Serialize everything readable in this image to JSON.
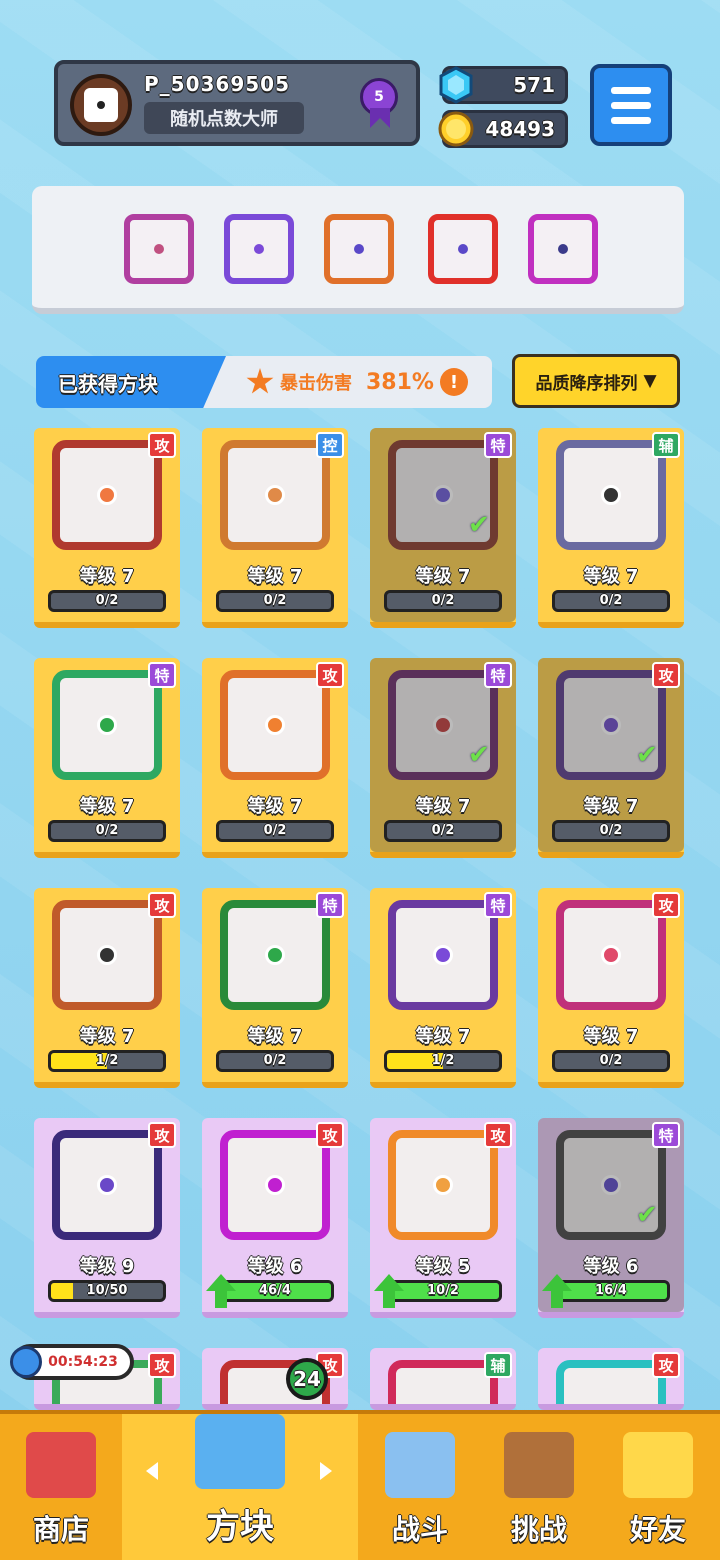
{
  "player": {
    "name": "P_50369505",
    "title": "随机点数大师",
    "rank": "5"
  },
  "currency": {
    "gems": "571",
    "gold": "48493"
  },
  "section": {
    "label": "已获得方块",
    "crit_label": "暴击伤害",
    "crit_value": "381%",
    "crit_info": "!"
  },
  "sort": {
    "label": "品质降序排列",
    "arrow": "▼"
  },
  "cards": [
    {
      "tag": "攻",
      "tag_type": "atk",
      "level": "等级 7",
      "progress": "0/2",
      "fill": 0,
      "frame": "#b0392f",
      "dotc": "#f07840",
      "owned": false
    },
    {
      "tag": "控",
      "tag_type": "ctl",
      "level": "等级 7",
      "progress": "0/2",
      "fill": 0,
      "frame": "#d07a30",
      "dotc": "#e08a48",
      "owned": false
    },
    {
      "tag": "特",
      "tag_type": "spc",
      "level": "等级 7",
      "progress": "0/2",
      "fill": 0,
      "frame": "#8a3a2a",
      "dotc": "#6a58d8",
      "owned": true
    },
    {
      "tag": "辅",
      "tag_type": "sup",
      "level": "等级 7",
      "progress": "0/2",
      "fill": 0,
      "frame": "#6a6aa0",
      "dotc": "#333333",
      "owned": false
    },
    {
      "tag": "特",
      "tag_type": "spc",
      "level": "等级 7",
      "progress": "0/2",
      "fill": 0,
      "frame": "#2ea862",
      "dotc": "#2ea84a",
      "owned": false
    },
    {
      "tag": "攻",
      "tag_type": "atk",
      "level": "等级 7",
      "progress": "0/2",
      "fill": 0,
      "frame": "#e0702a",
      "dotc": "#f08030",
      "owned": false
    },
    {
      "tag": "特",
      "tag_type": "spc",
      "level": "等级 7",
      "progress": "0/2",
      "fill": 0,
      "frame": "#6a2a6a",
      "dotc": "#c03a3a",
      "owned": true
    },
    {
      "tag": "攻",
      "tag_type": "atk",
      "level": "等级 7",
      "progress": "0/2",
      "fill": 0,
      "frame": "#5a3a8a",
      "dotc": "#6a48c8",
      "owned": true
    },
    {
      "tag": "攻",
      "tag_type": "atk",
      "level": "等级 7",
      "progress": "1/2",
      "fill": 0.5,
      "frame": "#c05a2a",
      "dotc": "#333333",
      "owned": false
    },
    {
      "tag": "特",
      "tag_type": "spc",
      "level": "等级 7",
      "progress": "0/2",
      "fill": 0,
      "frame": "#2a8a3a",
      "dotc": "#2ea84a",
      "owned": false
    },
    {
      "tag": "特",
      "tag_type": "spc",
      "level": "等级 7",
      "progress": "1/2",
      "fill": 0.5,
      "frame": "#6a3aa0",
      "dotc": "#7a4ad8",
      "owned": false
    },
    {
      "tag": "攻",
      "tag_type": "atk",
      "level": "等级 7",
      "progress": "0/2",
      "fill": 0,
      "frame": "#c0307a",
      "dotc": "#e04a6a",
      "owned": false
    },
    {
      "tag": "攻",
      "tag_type": "atk",
      "level": "等级 9",
      "progress": "10/50",
      "fill": 0.2,
      "frame": "#3a2a7a",
      "dotc": "#6a48c8",
      "owned": false
    },
    {
      "tag": "攻",
      "tag_type": "atk",
      "level": "等级 6",
      "progress": "46/4",
      "fill": 1,
      "frame": "#c020d0",
      "dotc": "#c020d0",
      "owned": false,
      "upgrade": true
    },
    {
      "tag": "攻",
      "tag_type": "atk",
      "level": "等级 5",
      "progress": "10/2",
      "fill": 1,
      "frame": "#f08a2a",
      "dotc": "#f0a040",
      "owned": false,
      "upgrade": true
    },
    {
      "tag": "特",
      "tag_type": "spc",
      "level": "等级 6",
      "progress": "16/4",
      "fill": 1,
      "frame": "#444444",
      "dotc": "#5a48c8",
      "owned": true,
      "upgrade": true
    },
    {
      "tag": "攻",
      "tag_type": "atk",
      "frame": "#3aaa5a"
    },
    {
      "tag": "攻",
      "tag_type": "atk",
      "frame": "#c03030"
    },
    {
      "tag": "辅",
      "tag_type": "sup",
      "frame": "#d02a5a"
    },
    {
      "tag": "攻",
      "tag_type": "atk",
      "frame": "#2ac0c0"
    }
  ],
  "timer": "00:54:23",
  "chest_badge": "24",
  "nav": [
    {
      "label": "商店",
      "color": "#e04a4a"
    },
    {
      "label": "方块",
      "color": "#5ab0f0"
    },
    {
      "label": "战斗",
      "color": "#8ac0f0"
    },
    {
      "label": "挑战",
      "color": "#b0703a"
    },
    {
      "label": "好友",
      "color": "#ffd84a"
    }
  ]
}
